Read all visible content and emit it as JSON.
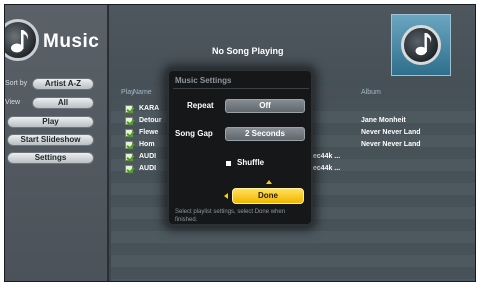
{
  "app": {
    "title": "Music",
    "now_playing": "No Song Playing"
  },
  "sidebar": {
    "sort_label": "Sort by",
    "sort_value": "Artist A-Z",
    "view_label": "View",
    "view_value": "All",
    "buttons": [
      "Play",
      "Start Slideshow",
      "Settings"
    ]
  },
  "table": {
    "columns": {
      "play": "Play",
      "name": "Name",
      "album": "Album"
    },
    "rows": [
      {
        "name": "KARA",
        "detail": "",
        "album": ""
      },
      {
        "name": "Detour",
        "detail": "",
        "album": "Jane Monheit"
      },
      {
        "name": "Flewe",
        "detail": "",
        "album": "Never Never Land"
      },
      {
        "name": "Hom",
        "detail": "",
        "album": "Never Never Land"
      },
      {
        "name": "AUDI",
        "detail": "sec44k ...",
        "album": ""
      },
      {
        "name": "AUDI",
        "detail": "sec44k ...",
        "album": ""
      }
    ]
  },
  "dialog": {
    "title": "Music Settings",
    "repeat_label": "Repeat",
    "repeat_value": "Off",
    "songgap_label": "Song Gap",
    "songgap_value": "2 Seconds",
    "shuffle_label": "Shuffle",
    "done_label": "Done",
    "hint": "Select playlist settings, select Done when finished."
  },
  "colors": {
    "accent": "#f2b400",
    "background": "#465158"
  },
  "icons": {
    "logo": "music-note-icon",
    "album_art": "music-note-icon",
    "check": "checkmark-icon"
  }
}
